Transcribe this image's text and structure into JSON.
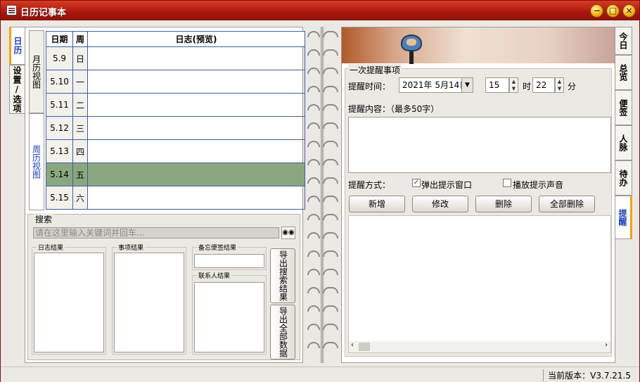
{
  "window": {
    "title": "日历记事本"
  },
  "left_tabs": [
    {
      "label": "日历"
    },
    {
      "label": "设置/选项"
    }
  ],
  "view_tabs": [
    {
      "label": "月历视图"
    },
    {
      "label": "周历视图"
    }
  ],
  "calendar": {
    "headers": {
      "date": "日期",
      "weekday": "周",
      "log": "日志(预览)"
    },
    "rows": [
      {
        "date": "5.9",
        "weekday": "日"
      },
      {
        "date": "5.10",
        "weekday": "一"
      },
      {
        "date": "5.11",
        "weekday": "二"
      },
      {
        "date": "5.12",
        "weekday": "三"
      },
      {
        "date": "5.13",
        "weekday": "四"
      },
      {
        "date": "5.14",
        "weekday": "五",
        "selected": true
      },
      {
        "date": "5.15",
        "weekday": "六"
      }
    ]
  },
  "search": {
    "label": "搜索",
    "placeholder": "请在这里输入关键词并回车...",
    "log_results": "日志结果",
    "item_results": "事项结果",
    "memo_results": "备忘便签结果",
    "contact_results": "联系人结果",
    "export_search": "导出搜索结果",
    "export_all": "导出全部数据"
  },
  "reminder": {
    "group_label": "一次提醒事项",
    "time_label": "提醒时间：",
    "date_value": "2021年 5月14日",
    "hour": "15",
    "hour_unit": "时",
    "minute": "22",
    "minute_unit": "分",
    "content_label": "提醒内容：（最多50字）",
    "method_label": "提醒方式：",
    "popup_label": "弹出提示窗口",
    "popup_checked": true,
    "sound_label": "播放提示声音",
    "sound_checked": false,
    "buttons": {
      "add": "新增",
      "edit": "修改",
      "delete": "删除",
      "delete_all": "全部删除"
    }
  },
  "right_tabs": [
    {
      "label": "今日"
    },
    {
      "label": "总览"
    },
    {
      "label": "便签"
    },
    {
      "label": "人脉"
    },
    {
      "label": "待办"
    },
    {
      "label": "提醒"
    }
  ],
  "status": {
    "version": "当前版本：V3.7.21.5"
  }
}
